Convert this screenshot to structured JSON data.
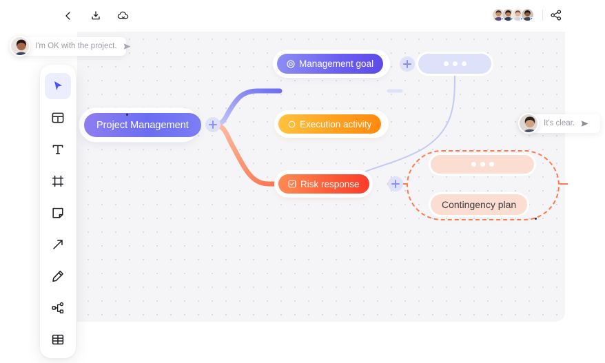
{
  "app": {
    "title": "Mind Map Whiteboard",
    "canvas_bg": "#f5f5f7",
    "accent": "#4b53f6"
  },
  "topbar": {
    "back_label": "Back",
    "download_label": "Download",
    "cloud_label": "Cloud sync",
    "share_label": "Share",
    "collaborators": [
      {
        "name": "Collaborator 1",
        "status": "online",
        "status_color": "#2b5cff",
        "hair": "#3a2b24",
        "skin": "#c98f6e",
        "bg": "#e4d6c8"
      },
      {
        "name": "Collaborator 2",
        "status": "online",
        "status_color": "#2b5cff",
        "hair": "#221a16",
        "skin": "#b87d5c",
        "bg": "#d9cfc6"
      },
      {
        "name": "Collaborator 3",
        "status": "online",
        "status_color": "#2b5cff",
        "hair": "#6b5340",
        "skin": "#e2b899",
        "bg": "#efe6dc"
      },
      {
        "name": "Collaborator 4",
        "status": "online",
        "status_color": "#2b5cff",
        "hair": "#1b1512",
        "skin": "#8a5a3c",
        "bg": "#cfc3b8"
      }
    ]
  },
  "toolbar": {
    "tools": [
      {
        "id": "select",
        "label": "Select",
        "icon": "cursor-icon",
        "active": true
      },
      {
        "id": "template",
        "label": "Template",
        "icon": "layout-icon",
        "active": false
      },
      {
        "id": "text",
        "label": "Text",
        "icon": "text-icon",
        "active": false
      },
      {
        "id": "frame",
        "label": "Frame",
        "icon": "frame-icon",
        "active": false
      },
      {
        "id": "note",
        "label": "Sticky note",
        "icon": "note-icon",
        "active": false
      },
      {
        "id": "arrow",
        "label": "Arrow",
        "icon": "arrow-icon",
        "active": false
      },
      {
        "id": "pen",
        "label": "Pen",
        "icon": "pen-icon",
        "active": false
      },
      {
        "id": "mindmap",
        "label": "Mind map",
        "icon": "mindmap-icon",
        "active": false
      },
      {
        "id": "table",
        "label": "Table",
        "icon": "table-icon",
        "active": false
      }
    ]
  },
  "chat": [
    {
      "id": "chat-1",
      "message": "I'm OK with the project.",
      "send_label": "Send"
    },
    {
      "id": "chat-2",
      "message": "It's clear.",
      "send_label": "Send"
    }
  ],
  "mindmap": {
    "root": {
      "label": "Project Management",
      "color_from": "#8e7df0",
      "color_to": "#7b7ef4"
    },
    "branches": [
      {
        "id": "management-goal",
        "label": "Management goal",
        "icon": "target-icon",
        "color_from": "#8c8ef3",
        "color_to": "#5d4ae8",
        "link_color": "#9aa2ee"
      },
      {
        "id": "execution-activity",
        "label": "Execution activity",
        "icon": "circle-icon",
        "color_from": "#ffc23d",
        "color_to": "#ff8a0f",
        "link_color": "#fdc84a"
      },
      {
        "id": "risk-response",
        "label": "Risk response",
        "icon": "checklist-icon",
        "color_from": "#ff8a52",
        "color_to": "#f93c2a",
        "link_color": "#f97a55"
      }
    ],
    "placeholders": [
      {
        "id": "placeholder-blue",
        "label": "...",
        "color": "#dde1fa"
      },
      {
        "id": "placeholder-red",
        "label": "...",
        "color": "#fbddd1"
      }
    ],
    "leaf": {
      "id": "contingency-plan",
      "label": "Contingency plan",
      "color": "#fbddd1",
      "text_color": "#3a3a42"
    },
    "selection": {
      "style": "dashed",
      "color": "#fb7a4e"
    },
    "add_buttons": [
      {
        "id": "add-root-child",
        "label": "+"
      },
      {
        "id": "add-goal-child",
        "label": "+"
      },
      {
        "id": "add-risk-child",
        "label": "+"
      }
    ]
  }
}
